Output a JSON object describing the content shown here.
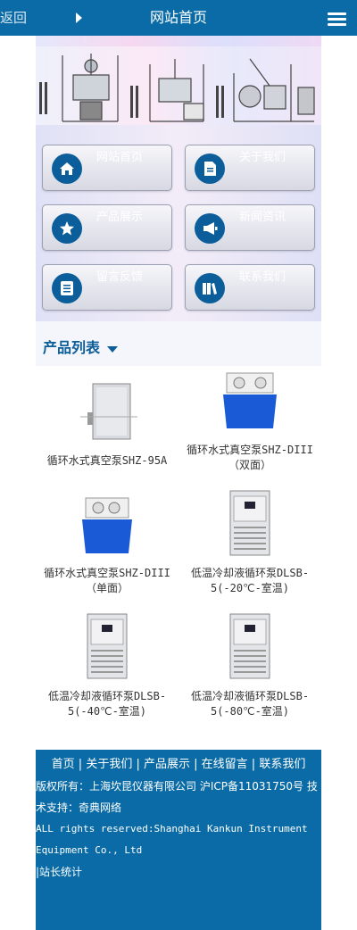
{
  "header": {
    "back_label": "返回",
    "title": "网站首页",
    "menu_icon": "hamburger-menu-icon"
  },
  "nav": [
    {
      "label": "网站首页",
      "icon": "home-icon"
    },
    {
      "label": "关于我们",
      "icon": "document-icon"
    },
    {
      "label": "产品展示",
      "icon": "star-icon"
    },
    {
      "label": "新闻资讯",
      "icon": "megaphone-icon"
    },
    {
      "label": "留言反馈",
      "icon": "notes-icon"
    },
    {
      "label": "联系我们",
      "icon": "books-icon"
    }
  ],
  "products_section": {
    "title": "产品列表",
    "items": [
      {
        "name": "循环水式真空泵SHZ-95A"
      },
      {
        "name": "循环水式真空泵SHZ-DIII（双面）"
      },
      {
        "name": "循环水式真空泵SHZ-DIII（单面）"
      },
      {
        "name": "低温冷却液循环泵DLSB-5(-20℃-室温)"
      },
      {
        "name": "低温冷却液循环泵DLSB-5(-40℃-室温)"
      },
      {
        "name": "低温冷却液循环泵DLSB-5(-80℃-室温)"
      }
    ]
  },
  "footer": {
    "links": [
      "首页",
      "关于我们",
      "产品展示",
      "在线留言",
      "联系我们"
    ],
    "copyright": "版权所有：上海坎昆仪器有限公司 沪ICP备11031750号 技术支持：奇典网络",
    "rights_en": "ALL rights reserved:Shanghai Kankun Instrument Equipment Co., Ltd",
    "stats": "|站长统计"
  },
  "colors": {
    "primary": "#0a6ba6",
    "icon_circle": "#0b5e99",
    "section_title": "#0b5e99"
  }
}
